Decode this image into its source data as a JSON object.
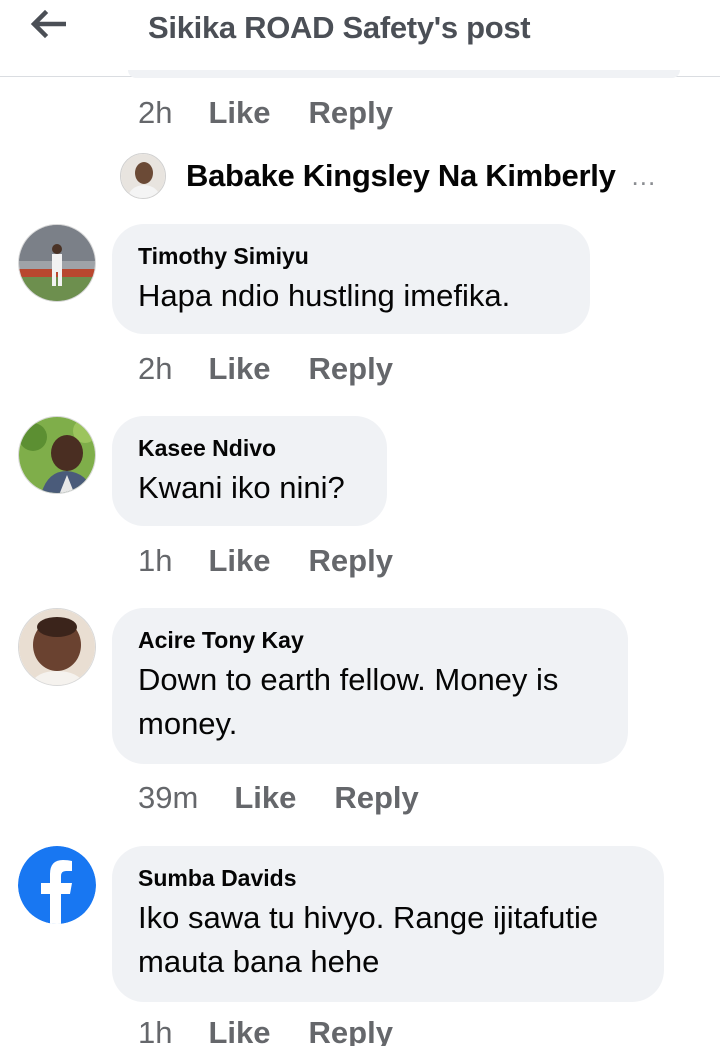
{
  "header": {
    "title": "Sikika ROAD Safety's post"
  },
  "top_actions": {
    "time": "2h",
    "like": "Like",
    "reply": "Reply"
  },
  "reply_preview": {
    "name": "Babake Kingsley Na Kimberly",
    "more": "..."
  },
  "comments": [
    {
      "author": "Timothy Simiyu",
      "text": "Hapa ndio hustling imefika.",
      "time": "2h",
      "like": "Like",
      "reply": "Reply"
    },
    {
      "author": "Kasee Ndivo",
      "text": "Kwani iko nini?",
      "time": "1h",
      "like": "Like",
      "reply": "Reply"
    },
    {
      "author": "Acire Tony Kay",
      "text": "Down to earth fellow. Money is money.",
      "time": "39m",
      "like": "Like",
      "reply": "Reply"
    },
    {
      "author": "Sumba Davids",
      "text": "Iko sawa tu hivyo. Range ijitafutie mauta bana hehe",
      "time": "1h",
      "like": "Like",
      "reply": "Reply"
    }
  ],
  "colors": {
    "bubble": "#f0f2f5",
    "secondary_text": "#65676b",
    "facebook_blue": "#1877f2"
  },
  "icons": {
    "back": "arrow-left-icon",
    "default_avatar": "facebook-logo-icon"
  }
}
